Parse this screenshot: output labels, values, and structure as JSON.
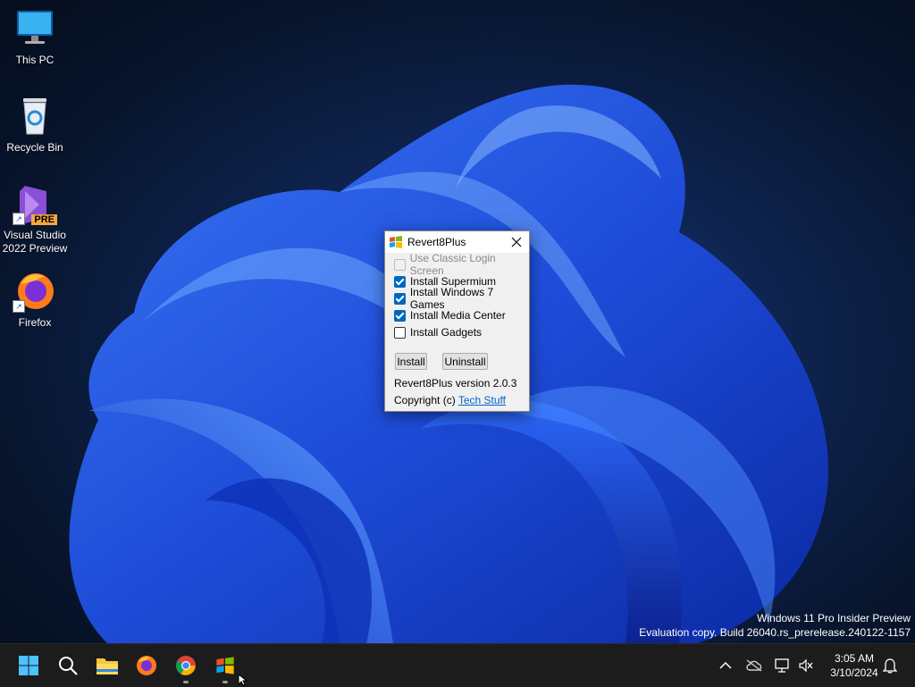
{
  "desktop": {
    "icons": [
      {
        "label": "This PC",
        "icon": "monitor-icon"
      },
      {
        "label": "Recycle Bin",
        "icon": "recycle-bin-icon"
      },
      {
        "label": "Visual Studio 2022 Preview",
        "icon": "visual-studio-icon",
        "badge": "PRE"
      },
      {
        "label": "Firefox",
        "icon": "firefox-icon"
      }
    ],
    "watermark": {
      "line1": "Windows 11 Pro Insider Preview",
      "line2": "Evaluation copy. Build 26040.rs_prerelease.240122-1157"
    }
  },
  "dialog": {
    "title": "Revert8Plus",
    "options": [
      {
        "label": "Use Classic Login Screen",
        "checked": false,
        "disabled": true
      },
      {
        "label": "Install Supermium",
        "checked": true,
        "disabled": false
      },
      {
        "label": "Install Windows 7 Games",
        "checked": true,
        "disabled": false
      },
      {
        "label": "Install Media Center",
        "checked": true,
        "disabled": false
      },
      {
        "label": "Install Gadgets",
        "checked": false,
        "disabled": false
      }
    ],
    "install_label": "Install",
    "uninstall_label": "Uninstall",
    "version_text": "Revert8Plus version 2.0.3",
    "copyright_prefix": "Copyright (c)",
    "copyright_link": "Tech Stuff"
  },
  "taskbar": {
    "apps": [
      "start-icon",
      "search-icon",
      "file-explorer-icon",
      "firefox-icon",
      "chrome-icon",
      "revert8plus-icon"
    ],
    "clock_time": "3:05 AM",
    "clock_date": "3/10/2024"
  },
  "colors": {
    "accent": "#0067c0",
    "link": "#0066cc",
    "taskbar": "#1c1c1c"
  }
}
